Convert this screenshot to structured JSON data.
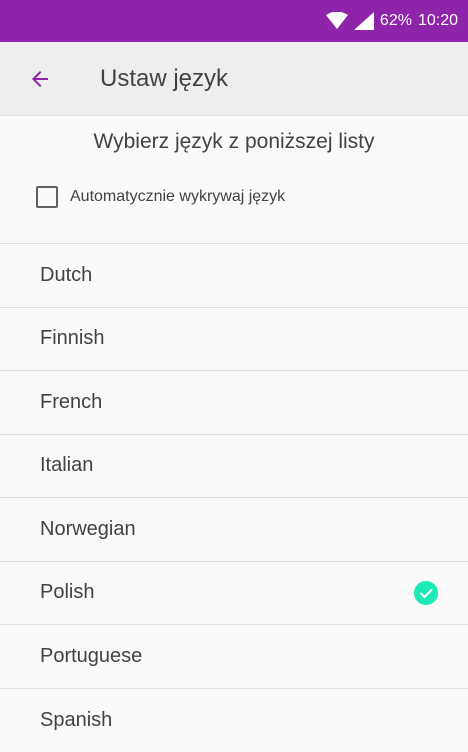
{
  "status_bar": {
    "battery": "62%",
    "time": "10:20",
    "background_color": "#8e24aa"
  },
  "app_bar": {
    "title": "Ustaw język",
    "back_icon": "arrow-left-icon",
    "accent_color": "#8e24aa"
  },
  "header": {
    "subtitle": "Wybierz język z poniższej listy",
    "auto_detect_label": "Automatycznie wykrywaj język",
    "auto_detect_checked": false
  },
  "languages": [
    {
      "label": "Dutch",
      "selected": false
    },
    {
      "label": "Finnish",
      "selected": false
    },
    {
      "label": "French",
      "selected": false
    },
    {
      "label": "Italian",
      "selected": false
    },
    {
      "label": "Norwegian",
      "selected": false
    },
    {
      "label": "Polish",
      "selected": true
    },
    {
      "label": "Portuguese",
      "selected": false
    },
    {
      "label": "Spanish",
      "selected": false
    }
  ],
  "selected_icon": "check-circle-icon",
  "selected_color": "#1de9b6"
}
